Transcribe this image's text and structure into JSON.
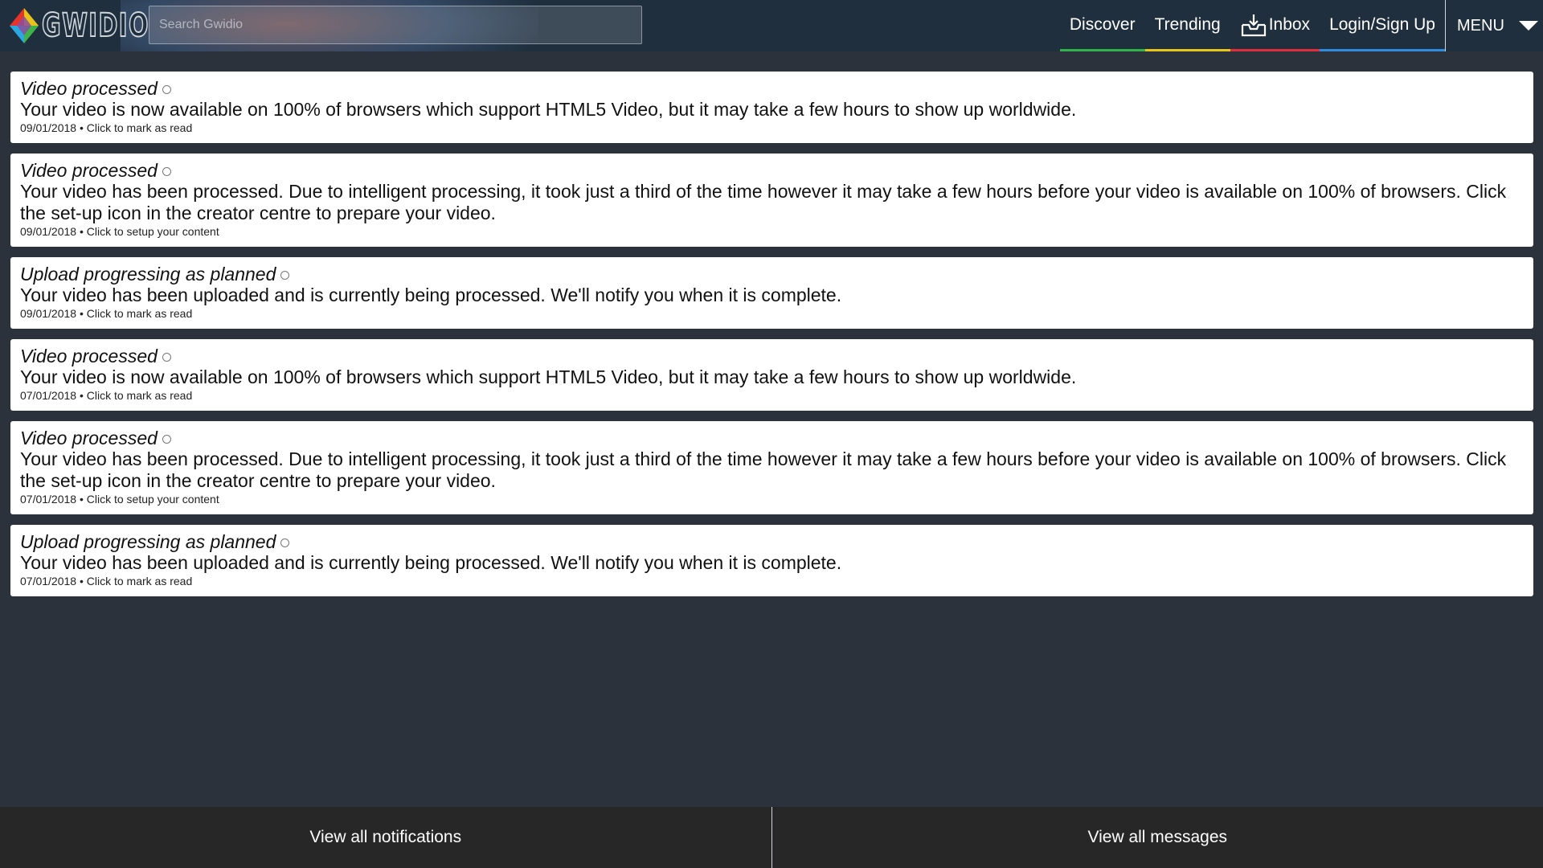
{
  "header": {
    "logo_text": "GWIDIO",
    "search_placeholder": "Search Gwidio",
    "nav": {
      "discover": "Discover",
      "trending": "Trending",
      "inbox": "Inbox",
      "login": "Login/Sign Up",
      "menu": "MENU"
    },
    "nav_colors": {
      "discover": "#2fb54a",
      "trending": "#e6c619",
      "inbox": "#e02f3a",
      "login": "#2e8de0"
    }
  },
  "notifications": [
    {
      "title": "Video processed",
      "body": "Your video is now available on 100% of browsers which support HTML5 Video, but it may take a few hours to show up worldwide.",
      "meta": "09/01/2018 • Click to mark as read"
    },
    {
      "title": "Video processed",
      "body": "Your video has been processed. Due to intelligent processing, it took just a third of the time however it may take a few hours before your video is available on 100% of browsers. Click the set-up icon in the creator centre to prepare your video.",
      "meta": "09/01/2018 • Click to setup your content"
    },
    {
      "title": "Upload progressing as planned",
      "body": "Your video has been uploaded and is currently being processed. We'll notify you when it is complete.",
      "meta": "09/01/2018 • Click to mark as read"
    },
    {
      "title": "Video processed",
      "body": "Your video is now available on 100% of browsers which support HTML5 Video, but it may take a few hours to show up worldwide.",
      "meta": "07/01/2018 • Click to mark as read"
    },
    {
      "title": "Video processed",
      "body": "Your video has been processed. Due to intelligent processing, it took just a third of the time however it may take a few hours before your video is available on 100% of browsers. Click the set-up icon in the creator centre to prepare your video.",
      "meta": "07/01/2018 • Click to setup your content"
    },
    {
      "title": "Upload progressing as planned",
      "body": "Your video has been uploaded and is currently being processed. We'll notify you when it is complete.",
      "meta": "07/01/2018 • Click to mark as read"
    }
  ],
  "footer": {
    "view_notifications": "View all notifications",
    "view_messages": "View all messages"
  }
}
